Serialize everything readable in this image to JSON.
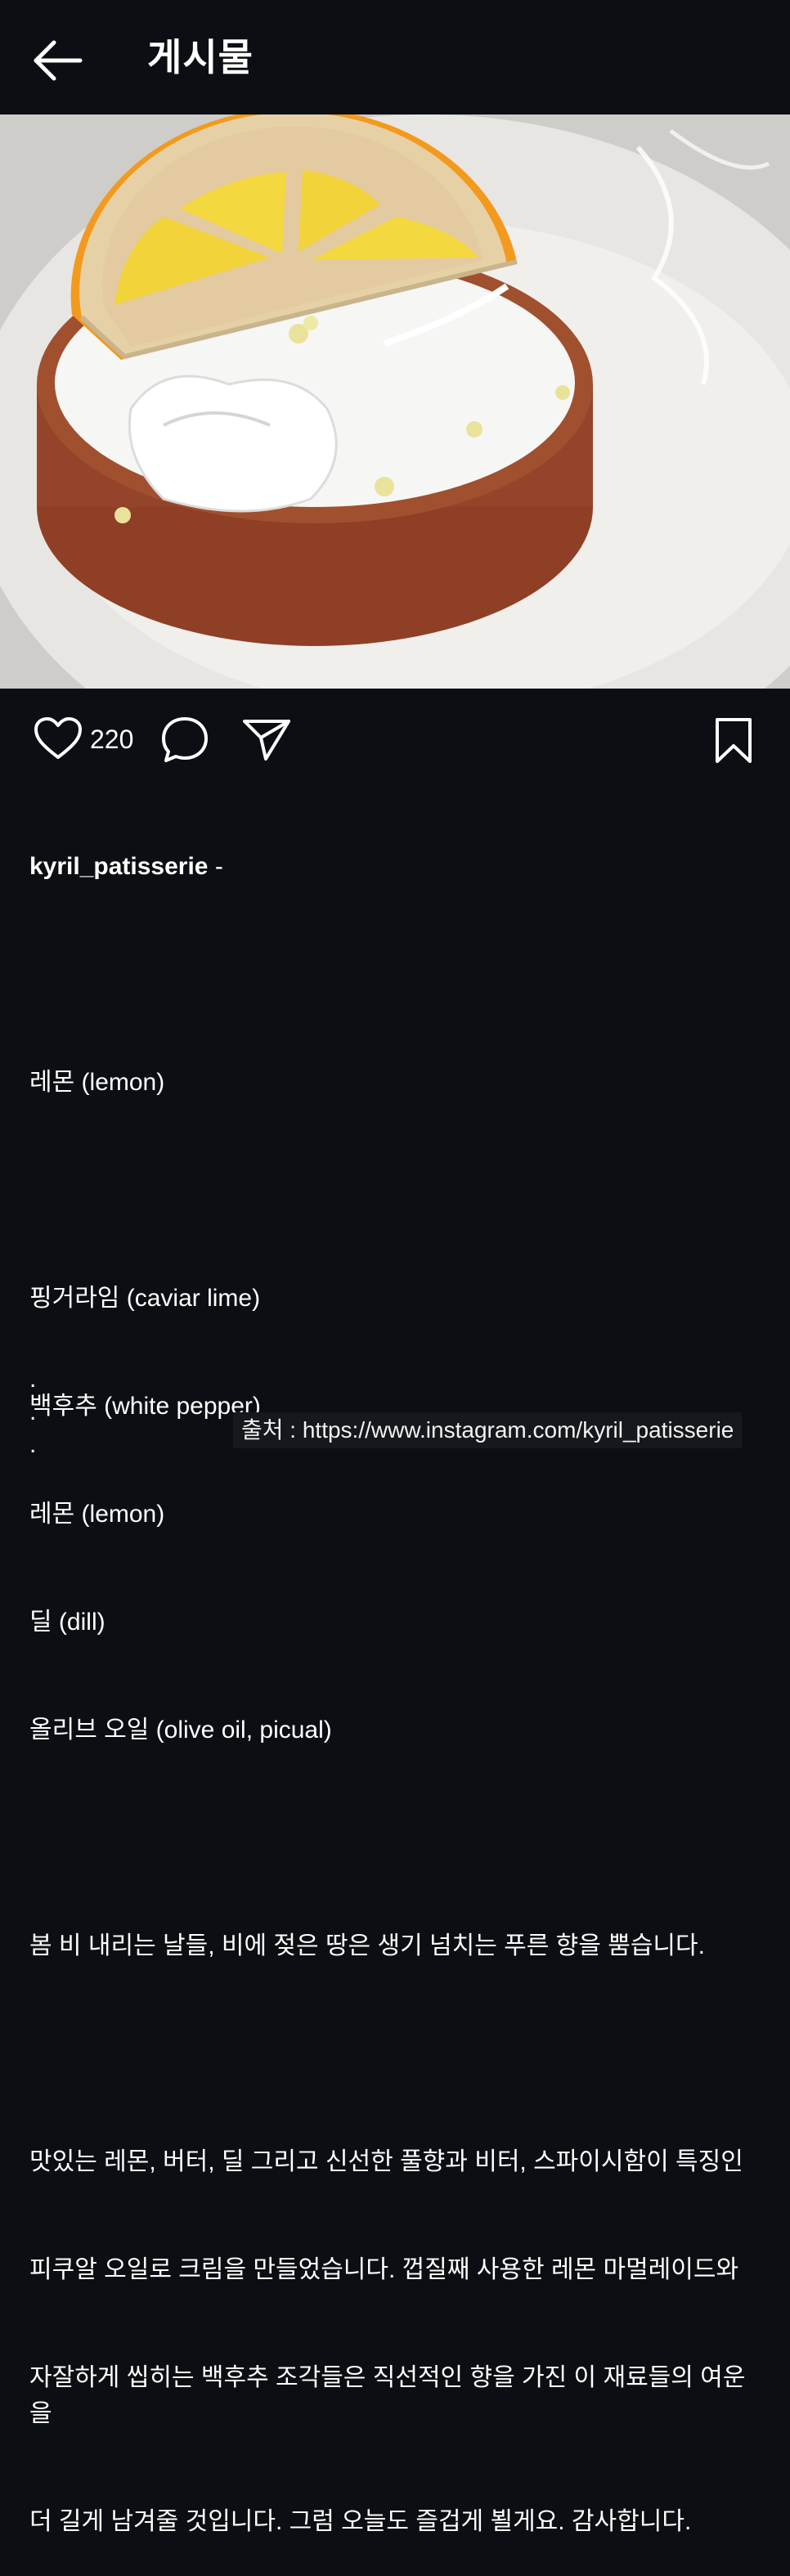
{
  "header": {
    "title": "게시물"
  },
  "post": {
    "image_alt": "Lemon tart topped with a lemon-slice decoration and cream",
    "likes": "220",
    "username": "kyril_patisserie",
    "username_suffix": " -",
    "caption_lines": [
      "레몬 (lemon)",
      "",
      "핑거라임 (caviar lime)",
      "백후추 (white pepper)",
      "레몬 (lemon)",
      "딜 (dill)",
      "올리브 오일 (olive oil, picual)",
      "",
      "봄 비 내리는 날들, 비에 젖은 땅은 생기 넘치는 푸른 향을 뿜습니다.",
      "",
      "맛있는 레몬, 버터, 딜 그리고 신선한 풀향과 비터, 스파이시함이 특징인",
      "피쿠알 오일로 크림을 만들었습니다. 껍질째 사용한 레몬 마멀레이드와",
      "자잘하게 씹히는 백후추 조각들은 직선적인 향을 가진 이 재료들의 여운을",
      "더 길게 남겨줄 것입니다. 그럼 오늘도 즐겁게 뵐게요. 감사합니다."
    ],
    "dots": [
      ".",
      ".",
      "."
    ]
  },
  "source_overlay": "출처 : https://www.instagram.com/kyril_patisserie",
  "colors": {
    "background": "#0b0e12",
    "text": "#ffffff"
  }
}
